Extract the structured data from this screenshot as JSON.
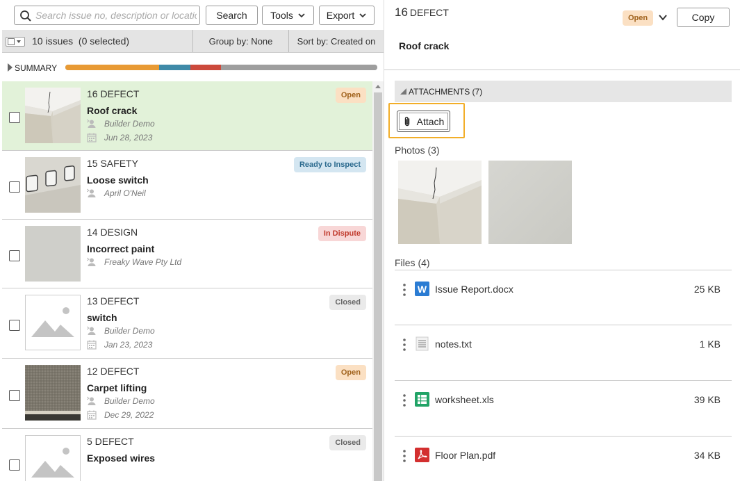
{
  "toolbar": {
    "search_placeholder": "Search issue no, description or location",
    "search_label": "Search",
    "tools_label": "Tools",
    "export_label": "Export"
  },
  "listbar": {
    "count_text": "10 issues  (0 selected)",
    "group_by": "Group by: None",
    "sort_by": "Sort by: Created on"
  },
  "summary": {
    "label": "SUMMARY",
    "segments": [
      {
        "status": "Open",
        "fraction": 0.3,
        "color": "#e89a34"
      },
      {
        "status": "Ready to Inspect",
        "fraction": 0.1,
        "color": "#3f8aa8"
      },
      {
        "status": "In Dispute",
        "fraction": 0.1,
        "color": "#cc4a3c"
      },
      {
        "status": "Closed",
        "fraction": 0.5,
        "color": "#9e9e9e"
      }
    ]
  },
  "issues": [
    {
      "number": "16 DEFECT",
      "title": "Roof crack",
      "assignee": "Builder Demo",
      "date": "Jun 28, 2023",
      "status": "Open",
      "status_class": "open",
      "thumb": "corner-crack"
    },
    {
      "number": "15 SAFETY",
      "title": "Loose switch",
      "assignee": "April O'Neil",
      "date": "",
      "status": "Ready to Inspect",
      "status_class": "ready",
      "thumb": "switches"
    },
    {
      "number": "14 DESIGN",
      "title": "Incorrect paint",
      "assignee": "Freaky Wave Pty Ltd",
      "date": "",
      "status": "In Dispute",
      "status_class": "dispute",
      "thumb": "wall"
    },
    {
      "number": "13 DEFECT",
      "title": "switch",
      "assignee": "Builder Demo",
      "date": "Jan 23, 2023",
      "status": "Closed",
      "status_class": "closed",
      "thumb": "placeholder"
    },
    {
      "number": "12 DEFECT",
      "title": "Carpet lifting",
      "assignee": "Builder Demo",
      "date": "Dec 29, 2022",
      "status": "Open",
      "status_class": "open",
      "thumb": "carpet"
    },
    {
      "number": "5 DEFECT",
      "title": "Exposed wires",
      "assignee": "",
      "date": "",
      "status": "Closed",
      "status_class": "closed",
      "thumb": "placeholder"
    }
  ],
  "detail": {
    "number": "16",
    "type": "DEFECT",
    "status": "Open",
    "copy_label": "Copy",
    "title": "Roof crack",
    "attachments_header": "ATTACHMENTS (7)",
    "attach_label": "Attach",
    "photos_label": "Photos (3)",
    "files_label": "Files (4)",
    "files": [
      {
        "name": "Issue Report.docx",
        "size": "25 KB",
        "icon": "word-icon"
      },
      {
        "name": "notes.txt",
        "size": "1 KB",
        "icon": "text-file-icon"
      },
      {
        "name": "worksheet.xls",
        "size": "39 KB",
        "icon": "spreadsheet-icon"
      },
      {
        "name": "Floor Plan.pdf",
        "size": "34 KB",
        "icon": "pdf-icon"
      }
    ]
  },
  "colors": {
    "selected_row": "#e2f2d9",
    "highlight": "#f2ae28",
    "word": "#2b7cd3",
    "sheet": "#21a366",
    "pdf": "#d32f2f"
  }
}
